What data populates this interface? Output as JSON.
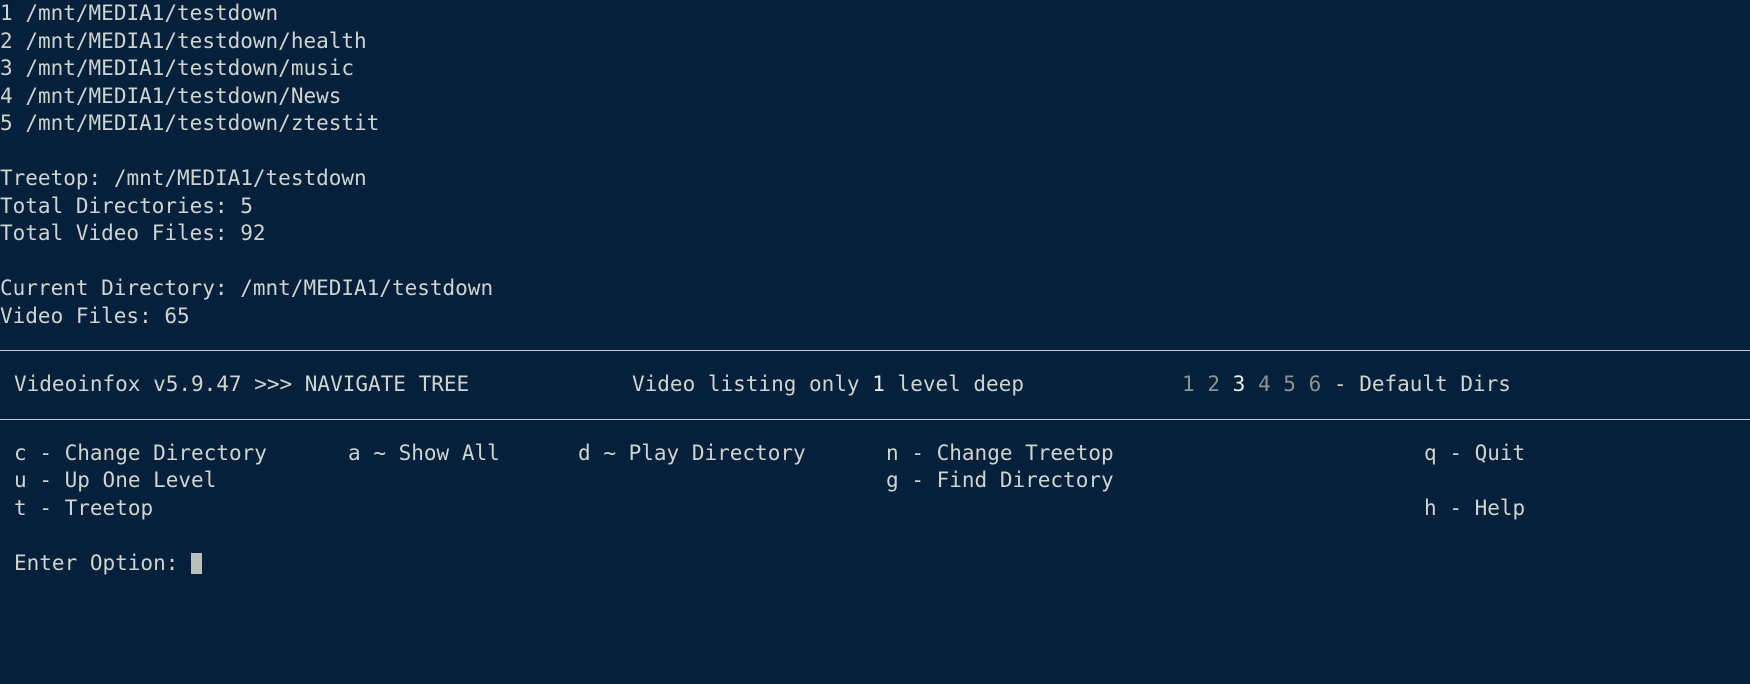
{
  "app": {
    "name": "Videoinfox",
    "version": "v5.9.47",
    "separator": ">>>",
    "mode": "NAVIGATE TREE",
    "title_line": "Videoinfox v5.9.47 >>> NAVIGATE TREE"
  },
  "directory_list": [
    {
      "index": "1",
      "path": "/mnt/MEDIA1/testdown"
    },
    {
      "index": "2",
      "path": "/mnt/MEDIA1/testdown/health"
    },
    {
      "index": "3",
      "path": "/mnt/MEDIA1/testdown/music"
    },
    {
      "index": "4",
      "path": "/mnt/MEDIA1/testdown/News"
    },
    {
      "index": "5",
      "path": "/mnt/MEDIA1/testdown/ztestit"
    }
  ],
  "summary": {
    "treetop_label": "Treetop:",
    "treetop_value": "/mnt/MEDIA1/testdown",
    "total_dirs_label": "Total Directories:",
    "total_dirs_value": "5",
    "total_videos_label": "Total Video Files:",
    "total_videos_value": "92"
  },
  "current": {
    "dir_label": "Current Directory:",
    "dir_value": "/mnt/MEDIA1/testdown",
    "video_files_label": "Video Files:",
    "video_files_value": "65"
  },
  "status_bar": {
    "listing_prefix": "Video listing only",
    "listing_depth": "1",
    "listing_suffix": "level deep",
    "default_dirs": [
      "1",
      "2",
      "3",
      "4",
      "5",
      "6"
    ],
    "default_dirs_selected": "3",
    "default_dirs_dash": "-",
    "default_dirs_label": "Default Dirs"
  },
  "menu": {
    "col1": [
      {
        "key": "c",
        "sep": "-",
        "label": "Change Directory"
      },
      {
        "key": "u",
        "sep": "-",
        "label": "Up One Level"
      },
      {
        "key": "t",
        "sep": "-",
        "label": "Treetop"
      }
    ],
    "col2": [
      {
        "key": "a",
        "sep": "~",
        "label": "Show All"
      }
    ],
    "col3": [
      {
        "key": "d",
        "sep": "~",
        "label": "Play Directory"
      }
    ],
    "col4": [
      {
        "key": "n",
        "sep": "-",
        "label": "Change Treetop"
      },
      {
        "key": "g",
        "sep": "-",
        "label": "Find Directory"
      }
    ],
    "col5": [
      {
        "key": "q",
        "sep": "-",
        "label": "Quit"
      },
      {
        "key": "h",
        "sep": "-",
        "label": "Help"
      }
    ]
  },
  "prompt": {
    "label": "Enter Option:",
    "value": ""
  },
  "colors": {
    "background": "#04203a",
    "text": "#cfd4d0",
    "dim": "#8d9390",
    "bright": "#e9eeea",
    "rule": "#c9cfca",
    "cursor": "#b9bfba"
  }
}
